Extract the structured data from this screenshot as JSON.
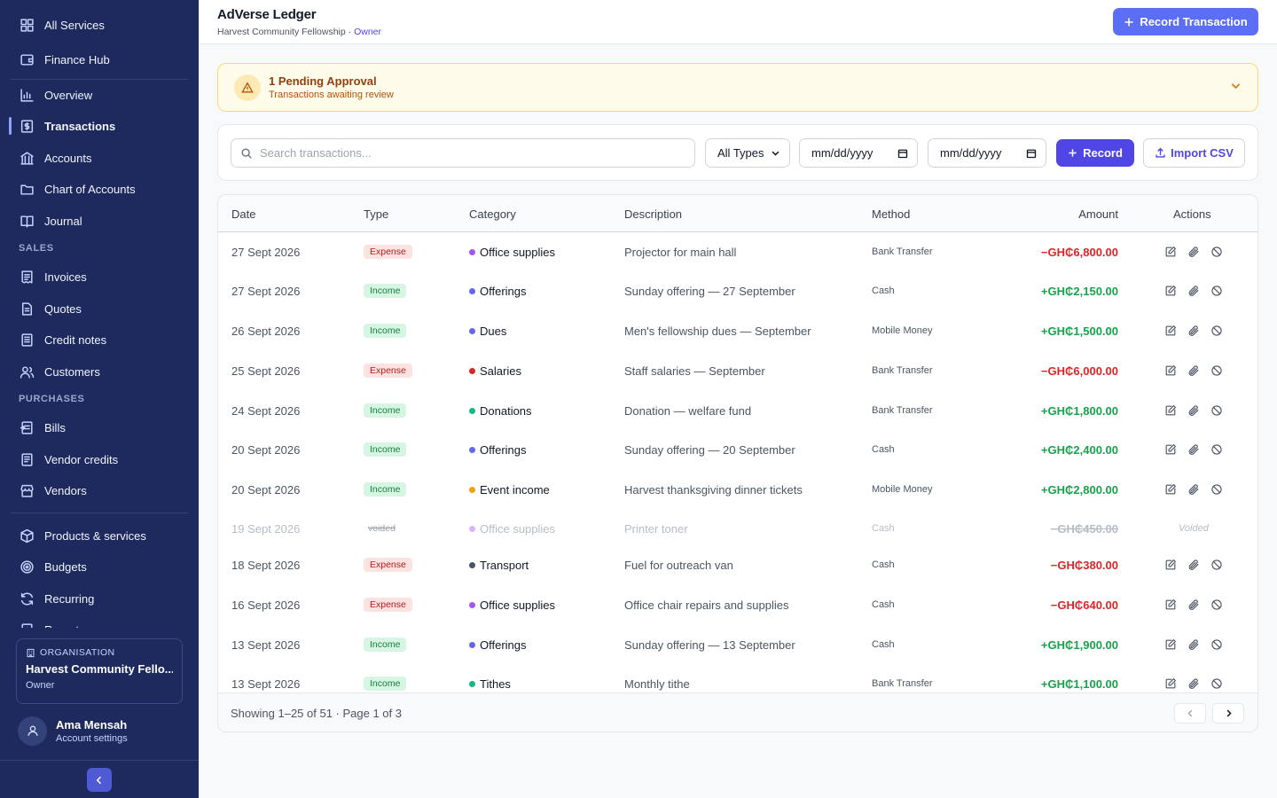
{
  "sidebar": {
    "top_items": [
      {
        "label": "All Services",
        "icon": "grid-icon"
      },
      {
        "label": "Finance Hub",
        "icon": "wallet-icon"
      }
    ],
    "main_items": [
      {
        "label": "Overview",
        "icon": "bar-chart-icon"
      },
      {
        "label": "Transactions",
        "icon": "dollar-receipt-icon",
        "active": true
      },
      {
        "label": "Accounts",
        "icon": "bank-icon"
      },
      {
        "label": "Chart of Accounts",
        "icon": "folder-icon"
      },
      {
        "label": "Journal",
        "icon": "book-icon"
      }
    ],
    "sales_label": "SALES",
    "sales_items": [
      {
        "label": "Invoices",
        "icon": "receipt-icon"
      },
      {
        "label": "Quotes",
        "icon": "document-icon"
      },
      {
        "label": "Credit notes",
        "icon": "list-document-icon"
      },
      {
        "label": "Customers",
        "icon": "users-icon"
      }
    ],
    "purchases_label": "PURCHASES",
    "purchases_items": [
      {
        "label": "Bills",
        "icon": "bill-icon"
      },
      {
        "label": "Vendor credits",
        "icon": "document-lines-icon"
      },
      {
        "label": "Vendors",
        "icon": "store-icon"
      }
    ],
    "other_items": [
      {
        "label": "Products & services",
        "icon": "package-icon"
      },
      {
        "label": "Budgets",
        "icon": "target-icon"
      },
      {
        "label": "Recurring",
        "icon": "refresh-icon"
      },
      {
        "label": "Reports",
        "icon": "report-icon"
      }
    ],
    "org": {
      "label": "ORGANISATION",
      "name": "Harvest Community Fello...",
      "role": "Owner"
    },
    "user": {
      "name": "Ama Mensah",
      "sub": "Account settings"
    }
  },
  "header": {
    "title": "AdVerse Ledger",
    "org": "Harvest Community Fellowship",
    "separator": " · ",
    "role": "Owner",
    "record_transaction_label": "Record Transaction"
  },
  "pending": {
    "title": "1 Pending Approval",
    "subtitle": "Transactions awaiting review"
  },
  "toolbar": {
    "search_placeholder": "Search transactions...",
    "type_filter": "All Types",
    "date_from": "mm/dd/yyyy",
    "date_to": "mm/dd/yyyy",
    "record_label": "Record",
    "import_label": "Import CSV"
  },
  "table": {
    "columns": [
      "Date",
      "Type",
      "Category",
      "Description",
      "Method",
      "Amount",
      "Actions"
    ],
    "rows": [
      {
        "date": "27 Sept 2026",
        "type": "Expense",
        "kind": "expense",
        "category": "Office supplies",
        "dot": "#a855f7",
        "description": "Projector for main hall",
        "method": "Bank Transfer",
        "amount": "−GH₵6,800.00"
      },
      {
        "date": "27 Sept 2026",
        "type": "Income",
        "kind": "income",
        "category": "Offerings",
        "dot": "#6366f1",
        "description": "Sunday offering — 27 September",
        "method": "Cash",
        "amount": "+GH₵2,150.00"
      },
      {
        "date": "26 Sept 2026",
        "type": "Income",
        "kind": "income",
        "category": "Dues",
        "dot": "#6366f1",
        "description": "Men's fellowship dues — September",
        "method": "Mobile Money",
        "amount": "+GH₵1,500.00"
      },
      {
        "date": "25 Sept 2026",
        "type": "Expense",
        "kind": "expense",
        "category": "Salaries",
        "dot": "#dc2626",
        "description": "Staff salaries — September",
        "method": "Bank Transfer",
        "amount": "−GH₵6,000.00"
      },
      {
        "date": "24 Sept 2026",
        "type": "Income",
        "kind": "income",
        "category": "Donations",
        "dot": "#10b981",
        "description": "Donation — welfare fund",
        "method": "Bank Transfer",
        "amount": "+GH₵1,800.00"
      },
      {
        "date": "20 Sept 2026",
        "type": "Income",
        "kind": "income",
        "category": "Offerings",
        "dot": "#6366f1",
        "description": "Sunday offering — 20 September",
        "method": "Cash",
        "amount": "+GH₵2,400.00"
      },
      {
        "date": "20 Sept 2026",
        "type": "Income",
        "kind": "income",
        "category": "Event income",
        "dot": "#f59e0b",
        "description": "Harvest thanksgiving dinner tickets",
        "method": "Mobile Money",
        "amount": "+GH₵2,800.00"
      },
      {
        "date": "19 Sept 2026",
        "type": "voided",
        "kind": "voided",
        "category": "Office supplies",
        "dot": "#d8b4fe",
        "description": "Printer toner",
        "method": "Cash",
        "amount": "−GH₵450.00",
        "voided_label": "Voided"
      },
      {
        "date": "18 Sept 2026",
        "type": "Expense",
        "kind": "expense",
        "category": "Transport",
        "dot": "#475569",
        "description": "Fuel for outreach van",
        "method": "Cash",
        "amount": "−GH₵380.00"
      },
      {
        "date": "16 Sept 2026",
        "type": "Expense",
        "kind": "expense",
        "category": "Office supplies",
        "dot": "#a855f7",
        "description": "Office chair repairs and supplies",
        "method": "Cash",
        "amount": "−GH₵640.00"
      },
      {
        "date": "13 Sept 2026",
        "type": "Income",
        "kind": "income",
        "category": "Offerings",
        "dot": "#6366f1",
        "description": "Sunday offering — 13 September",
        "method": "Cash",
        "amount": "+GH₵1,900.00"
      },
      {
        "date": "13 Sept 2026",
        "type": "Income",
        "kind": "income",
        "category": "Tithes",
        "dot": "#10b981",
        "description": "Monthly tithe",
        "method": "Bank Transfer",
        "amount": "+GH₵1,100.00"
      }
    ],
    "footer": "Showing 1–25 of 51 · Page 1 of 3"
  }
}
